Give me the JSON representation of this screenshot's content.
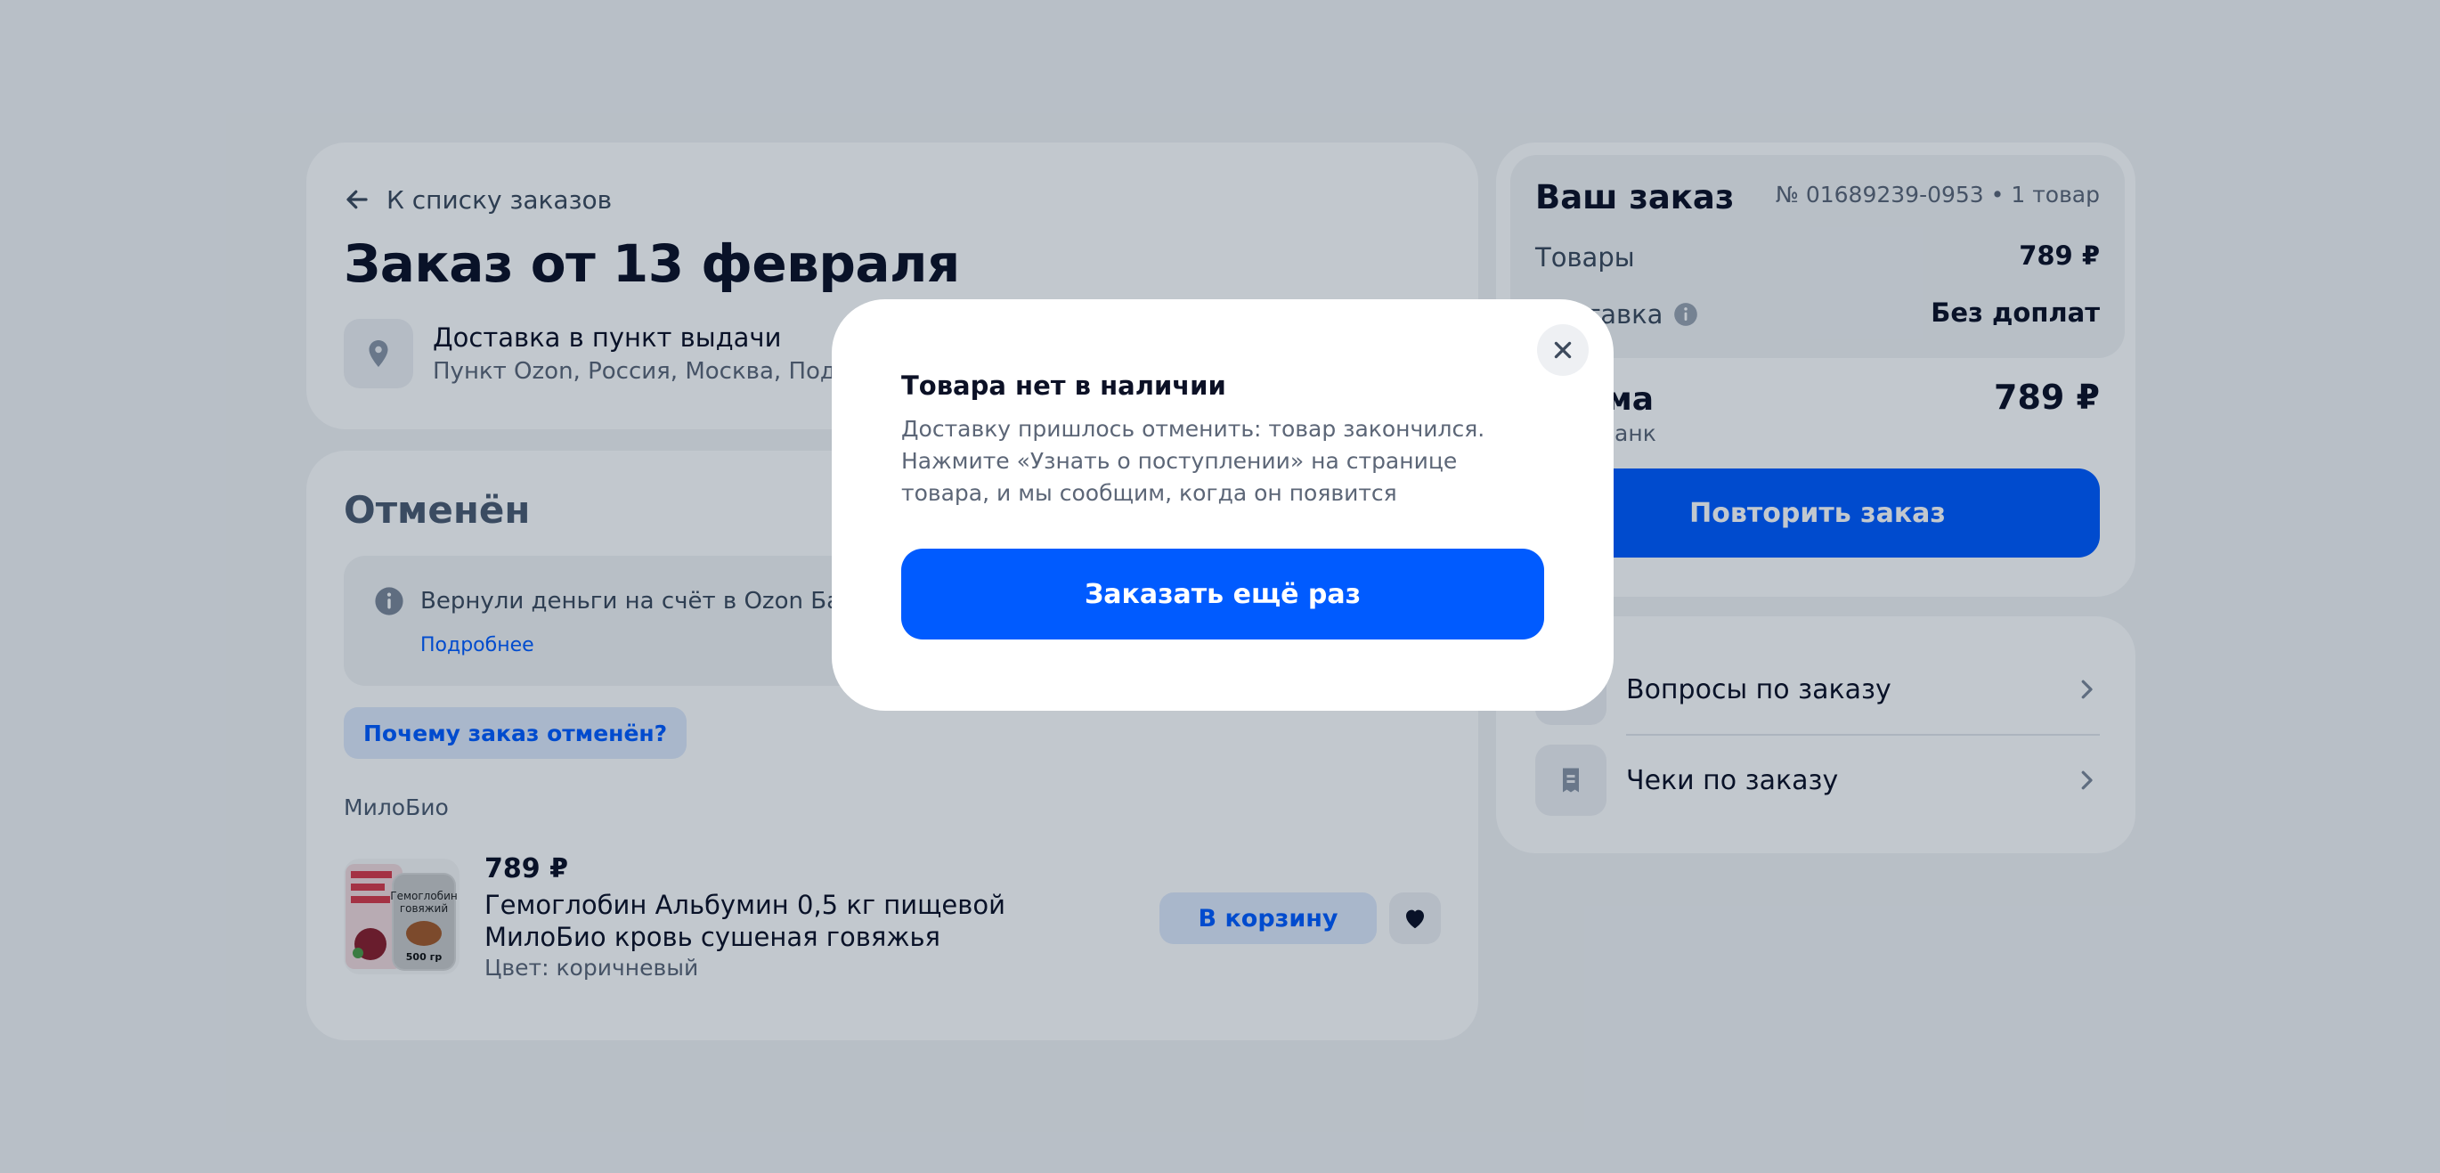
{
  "header": {
    "back_label": "К списку заказов",
    "title": "Заказ от 13 февраля",
    "delivery_type": "Доставка в пункт выдачи",
    "delivery_address": "Пункт Ozon, Россия, Москва, Подольск"
  },
  "status": {
    "title": "Отменён",
    "refund_text": "Вернули деньги на счёт в Ozon Банке",
    "refund_more": "Подробнее",
    "why_button": "Почему заказ отменён?",
    "seller": "МилоБио"
  },
  "product": {
    "price": "789 ₽",
    "name": "Гемоглобин Альбумин 0,5 кг пищевой МилоБио кровь сушеная говяжья",
    "color": "Цвет: коричневый",
    "image_label_1": "Гемоглобин",
    "image_label_2": "говяжий",
    "image_label_3": "500 гр",
    "cart_button": "В корзину"
  },
  "summary": {
    "title": "Ваш заказ",
    "number": "№ 01689239-0953 • 1 товар",
    "goods_label": "Товары",
    "goods_value": "789 ₽",
    "delivery_label": "Доставка",
    "delivery_value": "Без доплат",
    "total_label": "Сумма",
    "total_value": "789 ₽",
    "paid_with": "Ozon Банк",
    "repeat_button": "Повторить заказ"
  },
  "links": [
    {
      "label": "Вопросы по заказу",
      "icon": "chat-icon"
    },
    {
      "label": "Чеки по заказу",
      "icon": "receipt-icon"
    }
  ],
  "modal": {
    "title": "Товара нет в наличии",
    "text": "Доставку пришлось отменить: товар закончился. Нажмите «Узнать о поступлении» на странице товара, и мы сообщим, когда он появится",
    "button": "Заказать ещё раз"
  },
  "colors": {
    "accent": "#005bff",
    "background": "#f2f3f5",
    "overlay": "rgba(0, 26, 52, 0.24)"
  }
}
